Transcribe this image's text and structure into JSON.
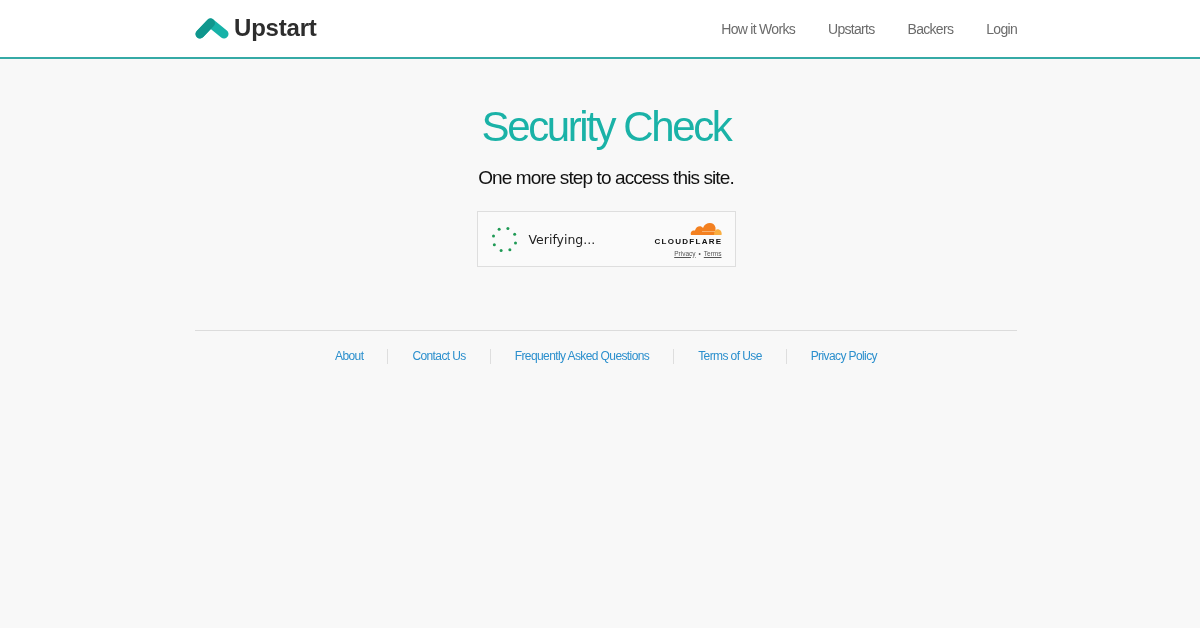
{
  "header": {
    "logo": "Upstart",
    "nav": [
      "How it Works",
      "Upstarts",
      "Backers",
      "Login"
    ]
  },
  "main": {
    "title": "Security Check",
    "subtitle": "One more step to access this site."
  },
  "challenge": {
    "status": "Verifying...",
    "brand": "CLOUDFLARE",
    "links": [
      "Privacy",
      "Terms"
    ],
    "separator": "•"
  },
  "footer": {
    "links": [
      "About",
      "Contact Us",
      "Frequently Asked Questions",
      "Terms of Use",
      "Privacy Policy"
    ]
  }
}
